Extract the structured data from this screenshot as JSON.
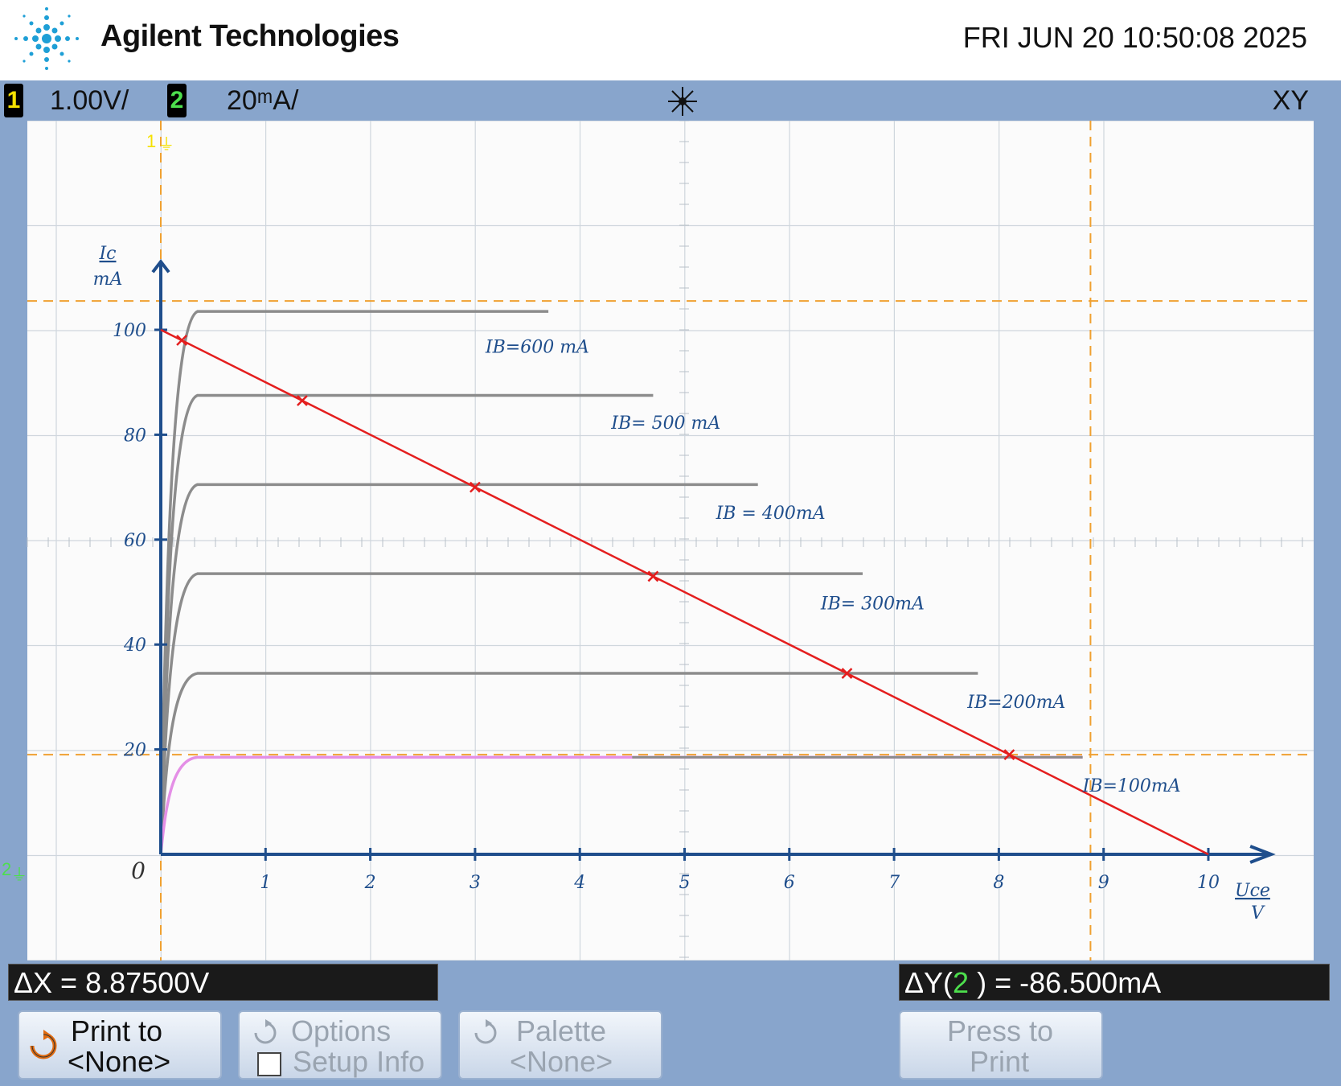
{
  "header": {
    "brand": "Agilent Technologies",
    "datetime": "FRI JUN 20 10:50:08 2025"
  },
  "statusbar": {
    "ch1_number": "1",
    "ch1_scale": "1.00V/",
    "ch2_number": "2",
    "ch2_scale": "20ᵐA/",
    "mode": "XY"
  },
  "readouts": {
    "dx": "ΔX = 8.87500V",
    "dy_prefix": "ΔY(",
    "dy_channel": "2",
    "dy_suffix": " ) = -86.500mA"
  },
  "softkeys": [
    {
      "line1": "Print to",
      "line2": "<None>",
      "enabled": true
    },
    {
      "line1": "Options",
      "line2": "Setup Info",
      "enabled": false
    },
    {
      "line1": "Palette",
      "line2": "<None>",
      "enabled": false
    },
    {
      "line1": "Press to",
      "line2": "Print",
      "enabled": false
    }
  ],
  "markers": {
    "ch1_ground": "1",
    "ch2_ground": "2"
  },
  "colors": {
    "screen_bg": "#88a5cc",
    "grid": "#cfd6dd",
    "trace": "#8c8c8c",
    "trace_pink": "#e48fe6",
    "load_line": "#e41e1e",
    "axes_ink": "#1f4e8c",
    "cursor": "#f0a030",
    "ch1": "#f5e100",
    "ch2": "#4ddf4d"
  },
  "chart_data": {
    "type": "line",
    "title": "",
    "xlabel": "Uce / V",
    "ylabel": "Ic / mA",
    "xlim": [
      0,
      10
    ],
    "ylim": [
      0,
      100
    ],
    "x_ticks": [
      0,
      1,
      2,
      3,
      4,
      5,
      6,
      7,
      8,
      9,
      10
    ],
    "x_tick_labels": [
      "0",
      "1",
      "2",
      "3",
      "4",
      "5",
      "6",
      "7",
      "8",
      "9",
      "10"
    ],
    "y_ticks": [
      20,
      40,
      60,
      80,
      100
    ],
    "y_tick_labels": [
      "20",
      "40",
      "60",
      "80",
      "100"
    ],
    "grid": true,
    "series": [
      {
        "name": "IB=600 mA",
        "label": "IB=600 mA",
        "ic_sat": 103.5,
        "x_end": 3.7
      },
      {
        "name": "IB= 500 mA",
        "label": "IB= 500 mA",
        "ic_sat": 87.5,
        "x_end": 4.7
      },
      {
        "name": "IB = 400mA",
        "label": "IB = 400mA",
        "ic_sat": 70.5,
        "x_end": 5.7
      },
      {
        "name": "IB= 300mA",
        "label": "IB= 300mA",
        "ic_sat": 53.5,
        "x_end": 6.7
      },
      {
        "name": "IB=200mA",
        "label": "IB=200mA",
        "ic_sat": 34.5,
        "x_end": 7.8
      },
      {
        "name": "IB=100mA",
        "label": "IB=100mA",
        "ic_sat": 18.5,
        "x_end": 8.8
      }
    ],
    "load_line": {
      "x": [
        0,
        10
      ],
      "y": [
        100,
        0
      ]
    },
    "operating_points": [
      {
        "x": 0.2,
        "y": 98
      },
      {
        "x": 1.35,
        "y": 86.5
      },
      {
        "x": 3.0,
        "y": 70
      },
      {
        "x": 4.7,
        "y": 53
      },
      {
        "x": 6.55,
        "y": 34.5
      },
      {
        "x": 8.1,
        "y": 19
      }
    ],
    "cursors": {
      "x": [
        0,
        8.875
      ],
      "y": [
        105.5,
        19
      ]
    }
  }
}
